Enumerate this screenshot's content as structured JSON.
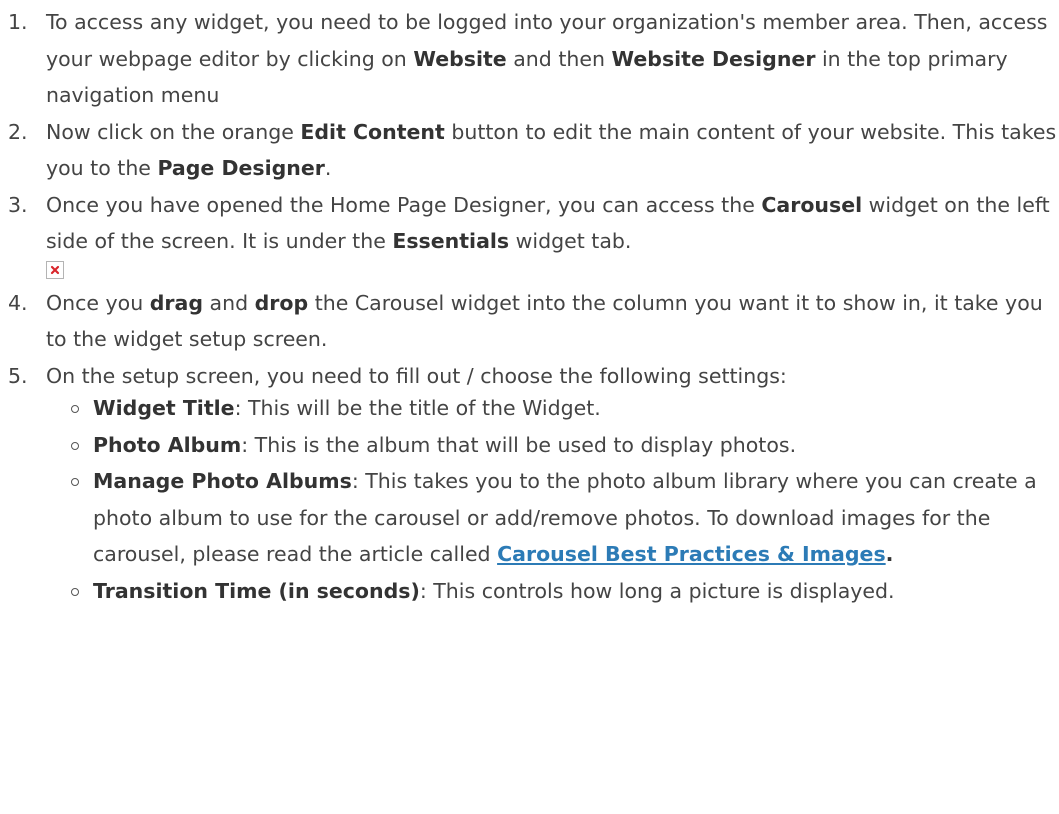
{
  "steps": [
    {
      "num": "1.",
      "t1": "To access any widget, you need to be logged into your organization's member area. Then, access your webpage editor by clicking on ",
      "b1": "Website",
      "t2": " and then ",
      "b2": "Website Designer",
      "t3": " in the top primary navigation menu"
    },
    {
      "num": "2.",
      "t1": "Now click on the orange ",
      "b1": "Edit Content",
      "t2": " button to edit the main content of your website. This takes you to the ",
      "b2": "Page Designer",
      "t3": "."
    },
    {
      "num": "3.",
      "t1": "Once you have opened the Home Page Designer, you can access the ",
      "b1": "Carousel",
      "t2": " widget on the left side of the screen. It is under the ",
      "b2": "Essentials",
      "t3": " widget tab.",
      "image_icon": "broken-image-icon"
    },
    {
      "num": "4.",
      "t1": "Once you ",
      "b1": "drag",
      "t2": " and ",
      "b2": "drop",
      "t3": " the Carousel widget into the column you want it to show in, it take you to the widget setup screen."
    },
    {
      "num": "5.",
      "t1": "On the setup screen, you need to fill out / choose the following settings:"
    }
  ],
  "settings": [
    {
      "name": "Widget Title",
      "desc": ": This will be the title of the Widget."
    },
    {
      "name": "Photo Album",
      "desc": ": This is the album that will be used to display photos."
    },
    {
      "name": "Manage Photo Albums",
      "desc": ": This takes you to the photo album library where you can create a photo album to use for the carousel or add/remove photos. To download images for the carousel, please read the article called ",
      "link": "Carousel Best Practices & Images",
      "after": "."
    },
    {
      "name": "Transition Time (in seconds)",
      "desc": ": This controls how long a picture is displayed."
    }
  ],
  "colors": {
    "text": "#444444",
    "link": "#2c7bb6",
    "broken_image_x": "#d9262c"
  }
}
